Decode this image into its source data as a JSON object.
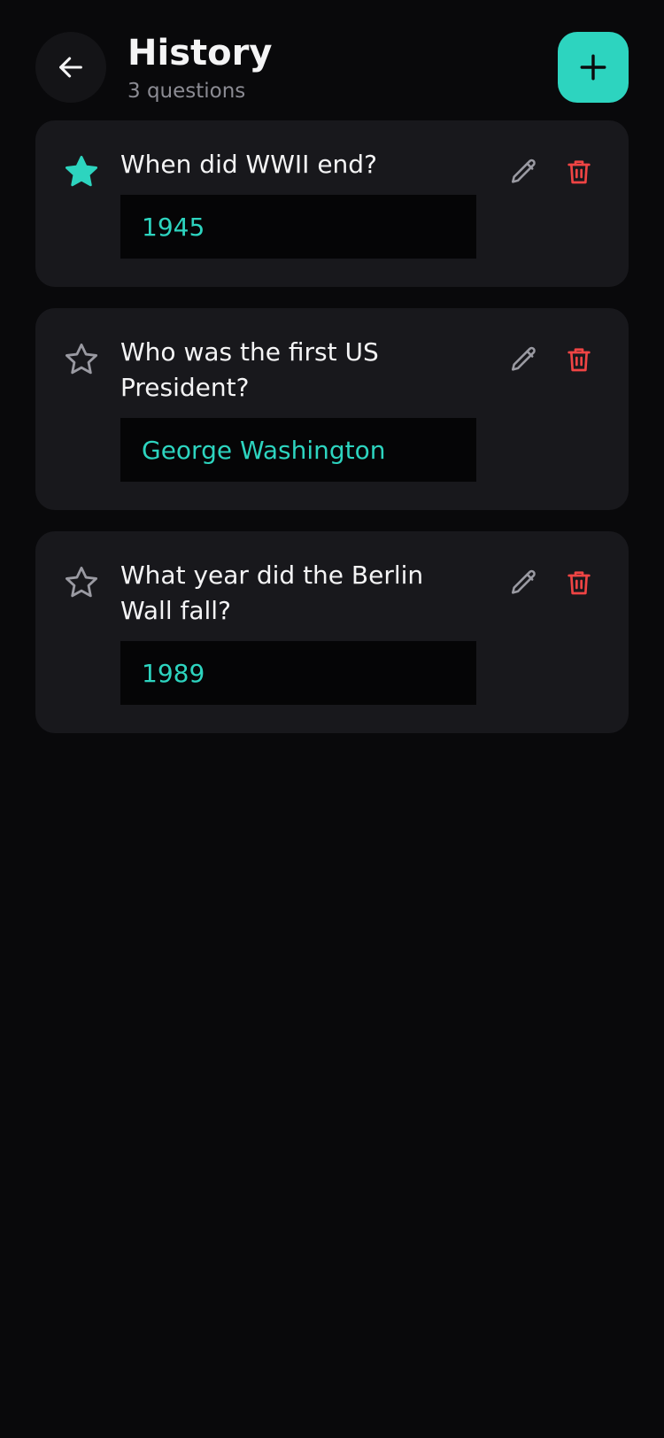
{
  "header": {
    "title": "History",
    "subtitle": "3 questions",
    "back_icon": "arrow-left-icon",
    "add_icon": "plus-icon"
  },
  "colors": {
    "background": "#09090b",
    "card": "#18181c",
    "answer_box": "#050506",
    "accent": "#2dd4bf",
    "muted_icon": "#9a9aa2",
    "danger": "#ef4444",
    "text": "#f4f4f5",
    "subtext": "#8b8b93"
  },
  "cards": [
    {
      "question": "When did WWII end?",
      "answer": "1945",
      "starred": true
    },
    {
      "question": "Who was the first US President?",
      "answer": "George Washington",
      "starred": false
    },
    {
      "question": "What year did the Berlin Wall fall?",
      "answer": "1989",
      "starred": false
    }
  ]
}
